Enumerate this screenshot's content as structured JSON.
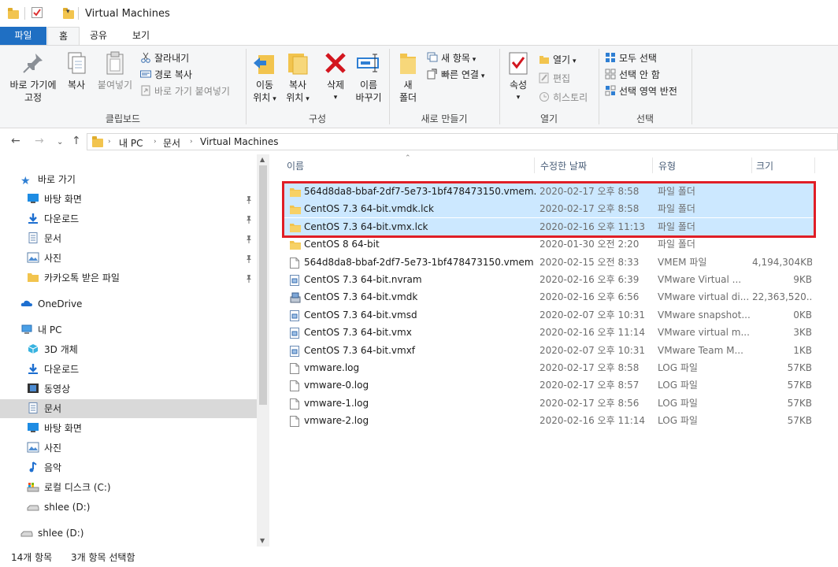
{
  "window": {
    "title": "Virtual Machines"
  },
  "tabs": [
    {
      "label": "파일"
    },
    {
      "label": "홈"
    },
    {
      "label": "공유"
    },
    {
      "label": "보기"
    }
  ],
  "ribbon": {
    "clipboard": {
      "label": "클립보드",
      "pin_line1": "바로 가기에",
      "pin_line2": "고정",
      "copy": "복사",
      "paste": "붙여넣기",
      "cut": "잘라내기",
      "copy_path": "경로 복사",
      "paste_shortcut": "바로 가기 붙여넣기"
    },
    "organize": {
      "label": "구성",
      "move_line1": "이동",
      "move_line2": "위치",
      "copyto_line1": "복사",
      "copyto_line2": "위치",
      "delete": "삭제",
      "rename_line1": "이름",
      "rename_line2": "바꾸기"
    },
    "new": {
      "label": "새로 만들기",
      "folder_line1": "새",
      "folder_line2": "폴더",
      "new_item": "새 항목",
      "easy_access": "빠른 연결"
    },
    "open": {
      "label": "열기",
      "properties": "속성",
      "open": "열기",
      "edit": "편집",
      "history": "히스토리"
    },
    "select": {
      "label": "선택",
      "select_all": "모두 선택",
      "select_none": "선택 안 함",
      "invert": "선택 영역 반전"
    }
  },
  "address": {
    "crumbs": [
      "내 PC",
      "문서",
      "Virtual Machines"
    ]
  },
  "nav": {
    "quick_access": "바로 가기",
    "items": [
      {
        "label": "바탕 화면",
        "icon": "desktop-icon"
      },
      {
        "label": "다운로드",
        "icon": "download-icon"
      },
      {
        "label": "문서",
        "icon": "documents-icon"
      },
      {
        "label": "사진",
        "icon": "pictures-icon"
      },
      {
        "label": "카카오톡 받은 파일",
        "icon": "folder-icon"
      }
    ],
    "onedrive": "OneDrive",
    "this_pc": "내 PC",
    "pc_items": [
      {
        "label": "3D 개체",
        "icon": "3d-objects-icon"
      },
      {
        "label": "다운로드",
        "icon": "download-icon"
      },
      {
        "label": "동영상",
        "icon": "videos-icon"
      },
      {
        "label": "문서",
        "icon": "documents-icon"
      },
      {
        "label": "바탕 화면",
        "icon": "desktop-icon"
      },
      {
        "label": "사진",
        "icon": "pictures-icon"
      },
      {
        "label": "음악",
        "icon": "music-icon"
      },
      {
        "label": "로컬 디스크 (C:)",
        "icon": "drive-icon"
      },
      {
        "label": "shlee (D:)",
        "icon": "drive-icon"
      }
    ],
    "bottom_drive": "shlee (D:)"
  },
  "columns": {
    "name": "이름",
    "date": "수정한 날짜",
    "type": "유형",
    "size": "크기"
  },
  "files": [
    {
      "name": "564d8da8-bbaf-2df7-5e73-1bf478473150.vmem.lck",
      "date": "2020-02-17 오후 8:58",
      "type": "파일 폴더",
      "size": "",
      "icon": "folder-icon"
    },
    {
      "name": "CentOS 7.3 64-bit.vmdk.lck",
      "date": "2020-02-17 오후 8:58",
      "type": "파일 폴더",
      "size": "",
      "icon": "folder-icon"
    },
    {
      "name": "CentOS 7.3 64-bit.vmx.lck",
      "date": "2020-02-16 오후 11:13",
      "type": "파일 폴더",
      "size": "",
      "icon": "folder-icon"
    },
    {
      "name": "CentOS 8 64-bit",
      "date": "2020-01-30 오전 2:20",
      "type": "파일 폴더",
      "size": "",
      "icon": "folder-icon"
    },
    {
      "name": "564d8da8-bbaf-2df7-5e73-1bf478473150.vmem",
      "date": "2020-02-15 오전 8:33",
      "type": "VMEM 파일",
      "size": "4,194,304KB",
      "icon": "file-icon"
    },
    {
      "name": "CentOS 7.3 64-bit.nvram",
      "date": "2020-02-16 오후 6:39",
      "type": "VMware Virtual ...",
      "size": "9KB",
      "icon": "vmware-file-icon"
    },
    {
      "name": "CentOS 7.3 64-bit.vmdk",
      "date": "2020-02-16 오후 6:56",
      "type": "VMware virtual di...",
      "size": "22,363,520...",
      "icon": "disk-file-icon"
    },
    {
      "name": "CentOS 7.3 64-bit.vmsd",
      "date": "2020-02-07 오후 10:31",
      "type": "VMware snapshot...",
      "size": "0KB",
      "icon": "vmware-file-icon"
    },
    {
      "name": "CentOS 7.3 64-bit.vmx",
      "date": "2020-02-16 오후 11:14",
      "type": "VMware virtual m...",
      "size": "3KB",
      "icon": "vmware-file-icon"
    },
    {
      "name": "CentOS 7.3 64-bit.vmxf",
      "date": "2020-02-07 오후 10:31",
      "type": "VMware Team M...",
      "size": "1KB",
      "icon": "vmware-file-icon"
    },
    {
      "name": "vmware.log",
      "date": "2020-02-17 오후 8:58",
      "type": "LOG 파일",
      "size": "57KB",
      "icon": "text-file-icon"
    },
    {
      "name": "vmware-0.log",
      "date": "2020-02-17 오후 8:57",
      "type": "LOG 파일",
      "size": "57KB",
      "icon": "text-file-icon"
    },
    {
      "name": "vmware-1.log",
      "date": "2020-02-17 오후 8:56",
      "type": "LOG 파일",
      "size": "57KB",
      "icon": "text-file-icon"
    },
    {
      "name": "vmware-2.log",
      "date": "2020-02-16 오후 11:14",
      "type": "LOG 파일",
      "size": "57KB",
      "icon": "text-file-icon"
    }
  ],
  "status": {
    "count": "14개 항목",
    "selected": "3개 항목 선택함"
  },
  "colors": {
    "accent": "#1f6fc3",
    "selection": "#cce8ff",
    "highlight_frame": "#e01e26",
    "folder": "#f2c44e"
  }
}
